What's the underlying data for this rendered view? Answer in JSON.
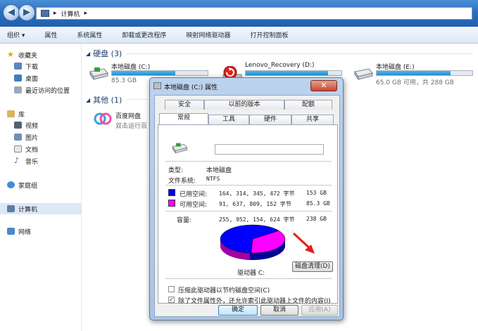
{
  "address": {
    "path": "计算机",
    "separator": "▸"
  },
  "toolbar": {
    "items": [
      "组织 ▾",
      "属性",
      "系统属性",
      "卸载或更改程序",
      "映射网络驱动器",
      "打开控制面板"
    ]
  },
  "sidebar": {
    "favorites": "收藏夹",
    "downloads": "下载",
    "desktop": "桌面",
    "recent": "最近访问的位置",
    "libraries": "库",
    "videos": "视频",
    "pictures": "图片",
    "documents": "文档",
    "music": "音乐",
    "homegroup": "家庭组",
    "computer": "计算机",
    "network": "网络"
  },
  "main": {
    "hard_disks_title": "硬盘 (3)",
    "other_title": "其他 (1)",
    "drives": [
      {
        "name": "本地磁盘 (C:)",
        "sub": "85.3 GB",
        "fill": 0.66
      },
      {
        "name": "Lenovo_Recovery (D:)",
        "sub": "",
        "fill": 0.86
      },
      {
        "name": "本地磁盘 (E:)",
        "sub": "65.0 GB 可用，共 288 GB",
        "fill": 0.77
      }
    ],
    "other_item": {
      "name": "百度网盘",
      "sub": "双击运行百"
    }
  },
  "dialog": {
    "title": "本地磁盘 (C:) 属性",
    "close_label": "✕",
    "tabs_row1": [
      "安全",
      "以前的版本",
      "配额"
    ],
    "tabs_row2": [
      "常规",
      "工具",
      "硬件",
      "共享"
    ],
    "type_label": "类型:",
    "type_value": "本地磁盘",
    "fs_label": "文件系统:",
    "fs_value": "NTFS",
    "used_label": "已用空间:",
    "used_bytes": "164, 314, 345, 472 字节",
    "used_gb": "153 GB",
    "free_label": "可用空间:",
    "free_bytes": "91, 637, 809, 152 字节",
    "free_gb": "85.3 GB",
    "capacity_label": "容量:",
    "capacity_bytes": "255, 952, 154, 624 字节",
    "capacity_gb": "238 GB",
    "drive_label": "驱动器 C:",
    "cleanup_button": "磁盘清理(D)",
    "compress_label": "压缩此驱动器以节约磁盘空间(C)",
    "index_label": "除了文件属性外，还允许索引此驱动器上文件的内容(I)",
    "ok_button": "确定",
    "cancel_button": "取消",
    "apply_button": "应用(A)",
    "used_fraction": 0.642,
    "colors": {
      "used": "#0000ff",
      "free": "#ff00ff"
    }
  }
}
